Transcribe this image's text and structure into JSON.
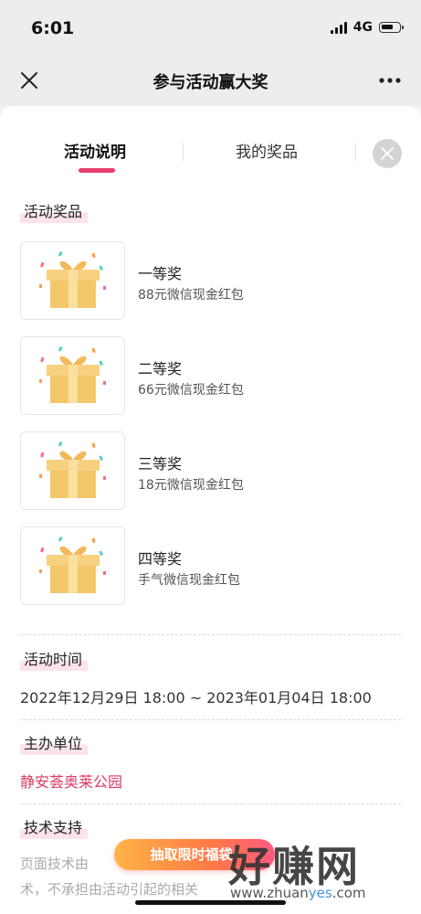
{
  "status_bar": {
    "time": "6:01",
    "network": "4G"
  },
  "navbar": {
    "title": "参与活动赢大奖"
  },
  "tabs": [
    {
      "label": "活动说明",
      "active": true
    },
    {
      "label": "我的奖品",
      "active": false
    }
  ],
  "sections": {
    "prizes_title": "活动奖品",
    "prizes": [
      {
        "name": "一等奖",
        "desc": "88元微信现金红包"
      },
      {
        "name": "二等奖",
        "desc": "66元微信现金红包"
      },
      {
        "name": "三等奖",
        "desc": "18元微信现金红包"
      },
      {
        "name": "四等奖",
        "desc": "手气微信现金红包"
      }
    ],
    "time_title": "活动时间",
    "time_value": "2022年12月29日 18:00 ~ 2023年01月04日 18:00",
    "organizer_title": "主办单位",
    "organizer_value": "静安荟奥莱公园",
    "tech_title": "技术支持",
    "tech_line1": "页面技术由",
    "tech_line2": "术，不承担由活动引起的相关"
  },
  "banner": {
    "label": "抽取限时福袋!"
  },
  "watermark": {
    "text": "好赚网",
    "url_prefix": "www.zhuan",
    "url_highlight": "yes",
    "url_suffix": ".com"
  },
  "colors": {
    "accent": "#e83e6e",
    "highlight": "#fbe3ea",
    "organizer": "#d93a66"
  }
}
